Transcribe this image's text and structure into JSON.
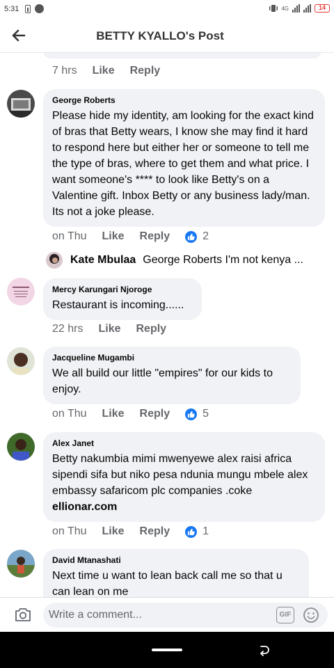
{
  "status_bar": {
    "time": "5:31",
    "network": "4G",
    "battery": "14"
  },
  "header": {
    "title": "BETTY KYALLO's Post"
  },
  "top_comment_actions": {
    "time": "7 hrs",
    "like": "Like",
    "reply": "Reply"
  },
  "comments": [
    {
      "author": "George Roberts",
      "text": "Please hide my identity, am looking for the exact kind of bras that Betty wears, I know she may find it hard to respond here but either her or someone to tell me the type of bras, where to get them and what price. I want someone's **** to look like Betty's on a Valentine gift. Inbox Betty or any business lady/man. Its not a joke please.",
      "time": "on Thu",
      "like": "Like",
      "reply": "Reply",
      "reactions": "2"
    },
    {
      "author": "Mercy Karungari Njoroge",
      "text": "Restaurant is incoming......",
      "time": "22 hrs",
      "like": "Like",
      "reply": "Reply"
    },
    {
      "author": "Jacqueline Mugambi",
      "text": "We all build our little \"empires\" for our kids to enjoy.",
      "time": "on Thu",
      "like": "Like",
      "reply": "Reply",
      "reactions": "5"
    },
    {
      "author": "Alex Janet",
      "text": "Betty nakumbia mimi mwenyewe alex   raisi africa sipendi sifa but niko pesa ndunia mungu mbele alex embassy safaricom plc companies .coke",
      "link": "ellionar.com",
      "time": "on Thu",
      "like": "Like",
      "reply": "Reply",
      "reactions": "1"
    },
    {
      "author": "David Mtanashati",
      "text": "Next time u want to lean back call me so that u can lean on me"
    }
  ],
  "reply_preview": {
    "author": "Kate Mbulaa",
    "text": "George Roberts I'm  not kenya ..."
  },
  "composer": {
    "placeholder": "Write a comment...",
    "gif": "GIF"
  },
  "colors": {
    "accent": "#1877f2",
    "bubble": "#f0f2f5",
    "muted": "#65676b",
    "battery_low": "#e53935"
  },
  "icons": [
    "back-arrow-icon",
    "like-thumb-icon",
    "camera-icon",
    "gif-icon",
    "emoji-icon"
  ]
}
